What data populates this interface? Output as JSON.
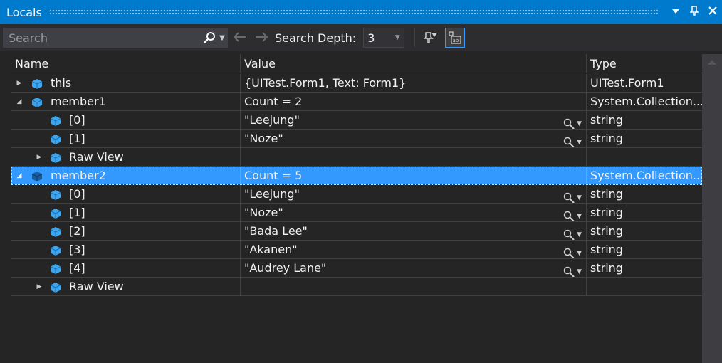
{
  "window": {
    "title": "Locals"
  },
  "toolbar": {
    "search_placeholder": "Search",
    "depth_label": "Search Depth:",
    "depth_value": "3"
  },
  "columns": {
    "name": "Name",
    "value": "Value",
    "type": "Type"
  },
  "rows": [
    {
      "name": "this",
      "value": "{UITest.Form1, Text: Form1}",
      "type": "UITest.Form1"
    },
    {
      "name": "member1",
      "value": "Count = 2",
      "type": "System.Collection..."
    },
    {
      "name": "[0]",
      "value": "\"Leejung\"",
      "type": "string"
    },
    {
      "name": "[1]",
      "value": "\"Noze\"",
      "type": "string"
    },
    {
      "name": "Raw View",
      "value": "",
      "type": ""
    },
    {
      "name": "member2",
      "value": "Count = 5",
      "type": "System.Collection..."
    },
    {
      "name": "[0]",
      "value": "\"Leejung\"",
      "type": "string"
    },
    {
      "name": "[1]",
      "value": "\"Noze\"",
      "type": "string"
    },
    {
      "name": "[2]",
      "value": "\"Bada Lee\"",
      "type": "string"
    },
    {
      "name": "[3]",
      "value": "\"Akanen\"",
      "type": "string"
    },
    {
      "name": "[4]",
      "value": "\"Audrey Lane\"",
      "type": "string"
    },
    {
      "name": "Raw View",
      "value": "",
      "type": ""
    }
  ],
  "colors": {
    "accent": "#007acc",
    "selection": "#3399ff",
    "background": "#252526"
  }
}
